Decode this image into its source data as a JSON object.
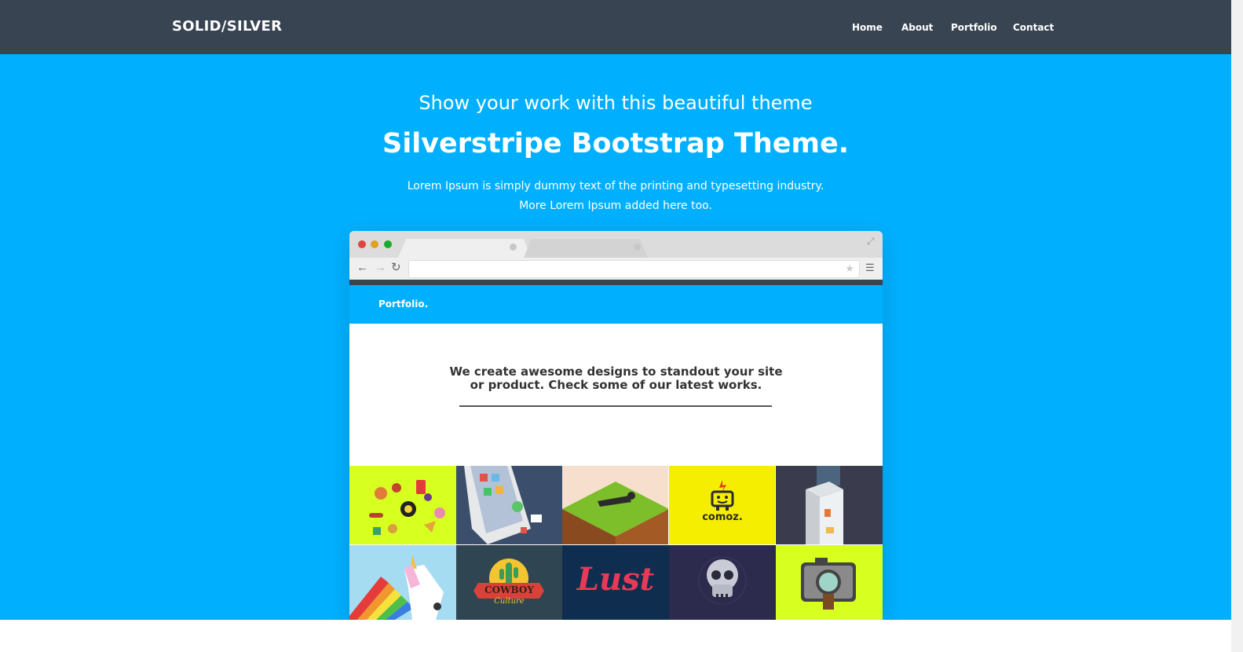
{
  "navbar": {
    "brand": "SOLID/SILVER",
    "items": [
      "Home",
      "About",
      "Portfolio",
      "Contact"
    ]
  },
  "hero": {
    "subtitle": "Show your work with this beautiful theme",
    "title": "Silverstripe Bootstrap Theme.",
    "paragraph_line1": "Lorem Ipsum is simply dummy text of the printing and typesetting industry.",
    "paragraph_line2": "More Lorem Ipsum added here too."
  },
  "mockup": {
    "brand": "Portfolio.",
    "heading_line1": "We create awesome designs to standout your site",
    "heading_line2": "or product. Check some of our latest works.",
    "tile_texts": {
      "comoz": "comoz.",
      "cowboy": "COWBOY",
      "culture": "Culture",
      "lust": "Lust"
    }
  },
  "colors": {
    "navbar": "#384452",
    "hero": "#00b0ff",
    "accent_lime": "#d7ff1f",
    "accent_yellow": "#f5ee00"
  }
}
